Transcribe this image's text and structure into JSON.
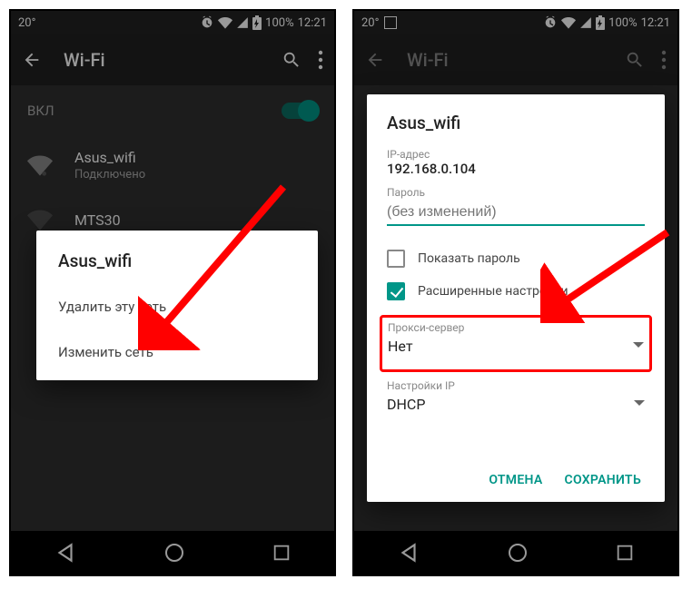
{
  "statusbar": {
    "temperature": "20°",
    "battery_text": "100%",
    "time": "12:21"
  },
  "appbar": {
    "title": "Wi-Fi"
  },
  "toggle": {
    "label": "ВКЛ"
  },
  "networks": [
    {
      "name": "Asus_wifi",
      "status": "Подключено"
    },
    {
      "name": "MTS30",
      "status": ""
    }
  ],
  "context_dialog": {
    "title": "Asus_wifi",
    "forget": "Удалить эту сеть",
    "modify": "Изменить сеть"
  },
  "edit_dialog": {
    "title": "Asus_wifi",
    "ip_label": "IP-адрес",
    "ip_value": "192.168.0.104",
    "password_label": "Пароль",
    "password_placeholder": "(без изменений)",
    "show_password": "Показать пароль",
    "advanced": "Расширенные настройки",
    "proxy_label": "Прокси-сервер",
    "proxy_value": "Нет",
    "ip_settings_label": "Настройки IP",
    "ip_settings_value": "DHCP",
    "cancel": "ОТМЕНА",
    "save": "СОХРАНИТЬ"
  }
}
